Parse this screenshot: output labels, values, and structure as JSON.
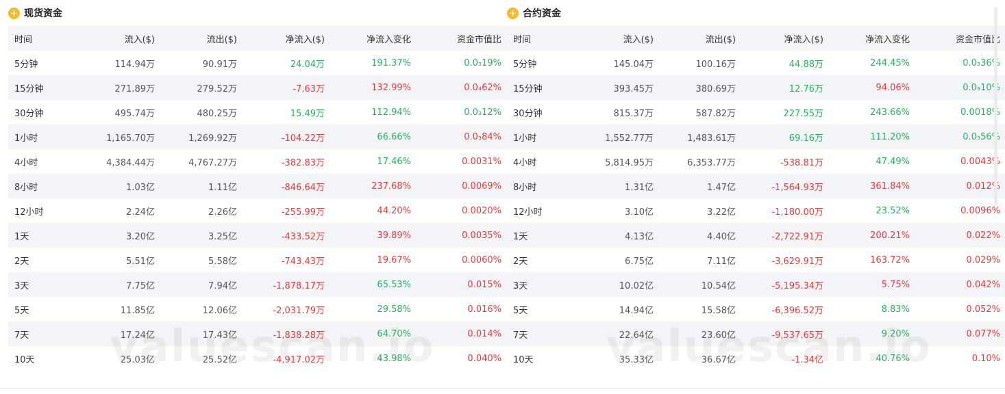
{
  "colors": {
    "positive": "#23b55a",
    "negative": "#ef3737",
    "header_bg": "#f2f4f7",
    "brand": "#f3ba2f"
  },
  "watermark": "valuescan.io",
  "spot": {
    "title": "现货资金",
    "icon": "bnb-coin-icon",
    "headers": [
      "时间",
      "流入($)",
      "流出($)",
      "净流入($)",
      "净流入变化",
      "资金市值比"
    ],
    "rows": [
      [
        "5分钟",
        "114.94万",
        "90.91万",
        "24.04万",
        "191.37%",
        "0.0₃19%"
      ],
      [
        "15分钟",
        "271.89万",
        "279.52万",
        "-7.63万",
        "132.99%",
        "0.0₄62%"
      ],
      [
        "30分钟",
        "495.74万",
        "480.25万",
        "15.49万",
        "112.94%",
        "0.0₃12%"
      ],
      [
        "1小时",
        "1,165.70万",
        "1,269.92万",
        "-104.22万",
        "66.66%",
        "0.0₃84%"
      ],
      [
        "4小时",
        "4,384.44万",
        "4,767.27万",
        "-382.83万",
        "17.46%",
        "0.0031%"
      ],
      [
        "8小时",
        "1.03亿",
        "1.11亿",
        "-846.64万",
        "237.68%",
        "0.0069%"
      ],
      [
        "12小时",
        "2.24亿",
        "2.26亿",
        "-255.99万",
        "44.20%",
        "0.0020%"
      ],
      [
        "1天",
        "3.20亿",
        "3.25亿",
        "-433.52万",
        "39.89%",
        "0.0035%"
      ],
      [
        "2天",
        "5.51亿",
        "5.58亿",
        "-743.43万",
        "19.67%",
        "0.0060%"
      ],
      [
        "3天",
        "7.75亿",
        "7.94亿",
        "-1,878.17万",
        "65.53%",
        "0.015%"
      ],
      [
        "5天",
        "11.85亿",
        "12.06亿",
        "-2,031.79万",
        "29.58%",
        "0.016%"
      ],
      [
        "7天",
        "17.24亿",
        "17.43亿",
        "-1,838.28万",
        "64.70%",
        "0.014%"
      ],
      [
        "10天",
        "25.03亿",
        "25.52亿",
        "-4,917.02万",
        "43.98%",
        "0.040%"
      ]
    ],
    "net_sign": [
      "pos",
      "neg",
      "pos",
      "neg",
      "neg",
      "neg",
      "neg",
      "neg",
      "neg",
      "neg",
      "neg",
      "neg",
      "neg"
    ],
    "change_sign": [
      "pos",
      "neg",
      "pos",
      "pos",
      "pos",
      "neg",
      "neg",
      "neg",
      "neg",
      "pos",
      "pos",
      "pos",
      "pos"
    ],
    "ratio_sign": [
      "pos",
      "neg",
      "pos",
      "neg",
      "neg",
      "neg",
      "neg",
      "neg",
      "neg",
      "neg",
      "neg",
      "neg",
      "neg"
    ]
  },
  "futures": {
    "title": "合约资金",
    "icon": "bnb-coin-icon",
    "headers": [
      "时间",
      "流入($)",
      "流出($)",
      "净流入($)",
      "净流入变化",
      "资金市值比"
    ],
    "rows": [
      [
        "5分钟",
        "145.04万",
        "100.16万",
        "44.88万",
        "244.45%",
        "0.0₃36%"
      ],
      [
        "15分钟",
        "393.45万",
        "380.69万",
        "12.76万",
        "94.06%",
        "0.0₃10%"
      ],
      [
        "30分钟",
        "815.37万",
        "587.82万",
        "227.55万",
        "243.66%",
        "0.0018%"
      ],
      [
        "1小时",
        "1,552.77万",
        "1,483.61万",
        "69.16万",
        "111.20%",
        "0.0₃56%"
      ],
      [
        "4小时",
        "5,814.95万",
        "6,353.77万",
        "-538.81万",
        "47.49%",
        "0.0043%"
      ],
      [
        "8小时",
        "1.31亿",
        "1.47亿",
        "-1,564.93万",
        "361.84%",
        "0.012%"
      ],
      [
        "12小时",
        "3.10亿",
        "3.22亿",
        "-1,180.00万",
        "23.52%",
        "0.0096%"
      ],
      [
        "1天",
        "4.13亿",
        "4.40亿",
        "-2,722.91万",
        "200.21%",
        "0.022%"
      ],
      [
        "2天",
        "6.75亿",
        "7.11亿",
        "-3,629.91万",
        "163.72%",
        "0.029%"
      ],
      [
        "3天",
        "10.02亿",
        "10.54亿",
        "-5,195.34万",
        "5.75%",
        "0.042%"
      ],
      [
        "5天",
        "14.94亿",
        "15.58亿",
        "-6,396.52万",
        "8.83%",
        "0.052%"
      ],
      [
        "7天",
        "22.64亿",
        "23.60亿",
        "-9,537.65万",
        "9.20%",
        "0.077%"
      ],
      [
        "10天",
        "35.33亿",
        "36.67亿",
        "-1.34亿",
        "40.76%",
        "0.10%"
      ]
    ],
    "net_sign": [
      "pos",
      "pos",
      "pos",
      "pos",
      "neg",
      "neg",
      "neg",
      "neg",
      "neg",
      "neg",
      "neg",
      "neg",
      "neg"
    ],
    "change_sign": [
      "pos",
      "neg",
      "pos",
      "pos",
      "pos",
      "neg",
      "pos",
      "neg",
      "neg",
      "neg",
      "pos",
      "pos",
      "pos"
    ],
    "ratio_sign": [
      "pos",
      "pos",
      "pos",
      "pos",
      "neg",
      "neg",
      "neg",
      "neg",
      "neg",
      "neg",
      "neg",
      "neg",
      "neg"
    ]
  }
}
